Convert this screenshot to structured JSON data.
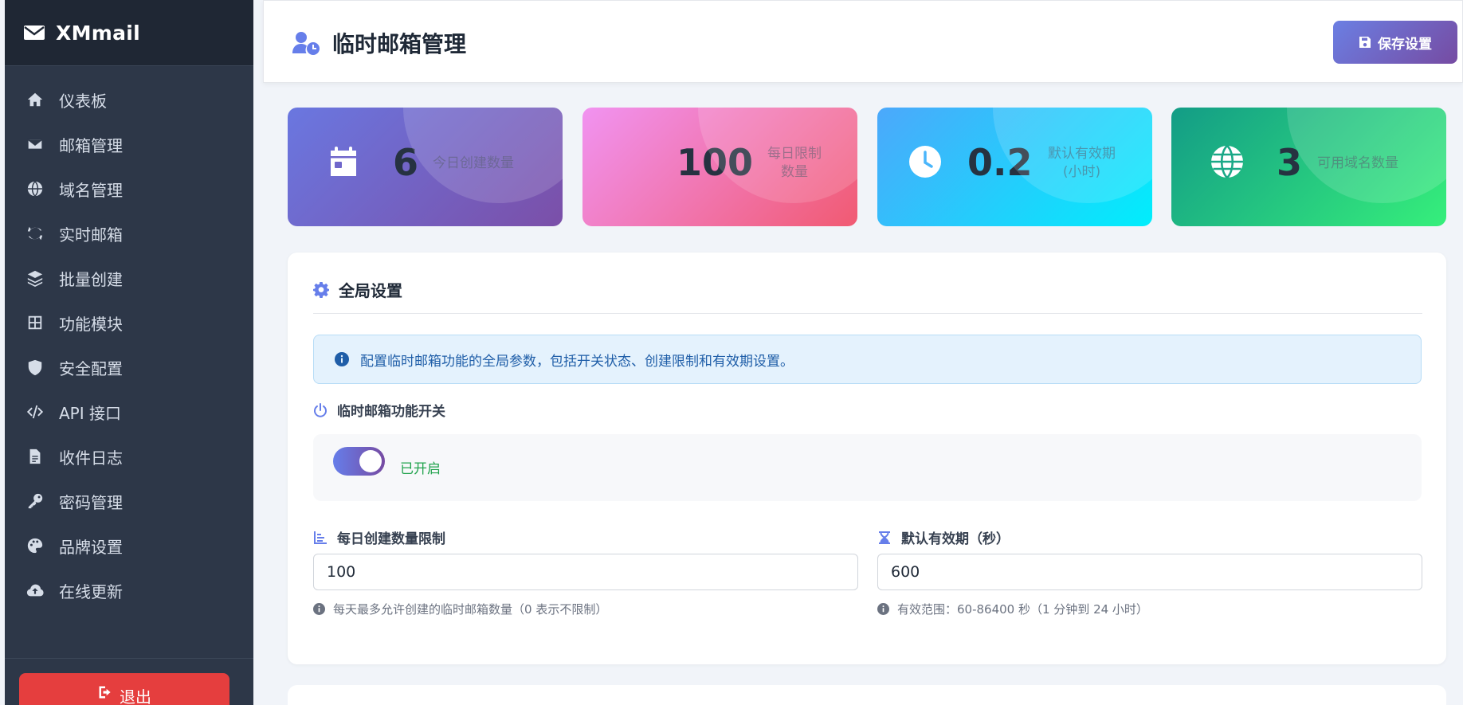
{
  "sidebar": {
    "brand": "XMmail",
    "items": [
      {
        "label": "仪表板",
        "icon": "home-icon"
      },
      {
        "label": "邮箱管理",
        "icon": "envelope-icon"
      },
      {
        "label": "域名管理",
        "icon": "globe-icon"
      },
      {
        "label": "实时邮箱",
        "icon": "refresh-icon"
      },
      {
        "label": "批量创建",
        "icon": "layers-icon"
      },
      {
        "label": "功能模块",
        "icon": "grid-icon"
      },
      {
        "label": "安全配置",
        "icon": "shield-icon"
      },
      {
        "label": "API 接口",
        "icon": "code-icon"
      },
      {
        "label": "收件日志",
        "icon": "file-icon"
      },
      {
        "label": "密码管理",
        "icon": "key-icon"
      },
      {
        "label": "品牌设置",
        "icon": "palette-icon"
      },
      {
        "label": "在线更新",
        "icon": "cloud-upload-icon"
      }
    ],
    "logout_label": "退出"
  },
  "header": {
    "title": "临时邮箱管理",
    "save_label": "保存设置"
  },
  "stats": [
    {
      "value": "6",
      "label": "今日创建数量"
    },
    {
      "value": "100",
      "label_line1": "每日限制",
      "label_line2": "数量"
    },
    {
      "value": "0.2",
      "label_line1": "默认有效期",
      "label_line2": "(小时)"
    },
    {
      "value": "3",
      "label": "可用域名数量"
    }
  ],
  "settings": {
    "title": "全局设置",
    "info": "配置临时邮箱功能的全局参数，包括开关状态、创建限制和有效期设置。",
    "switch_label": "临时邮箱功能开关",
    "switch_state": "已开启",
    "daily_limit_label": "每日创建数量限制",
    "daily_limit_value": "100",
    "daily_limit_hint": "每天最多允许创建的临时邮箱数量（0 表示不限制）",
    "expiry_label": "默认有效期（秒）",
    "expiry_value": "600",
    "expiry_hint": "有效范围：60-86400 秒（1 分钟到 24 小时）"
  },
  "colors": {
    "accent": "#667eea",
    "sidebar_bg": "#2d3748",
    "logout": "#e53e3e",
    "success": "#22a34d"
  }
}
